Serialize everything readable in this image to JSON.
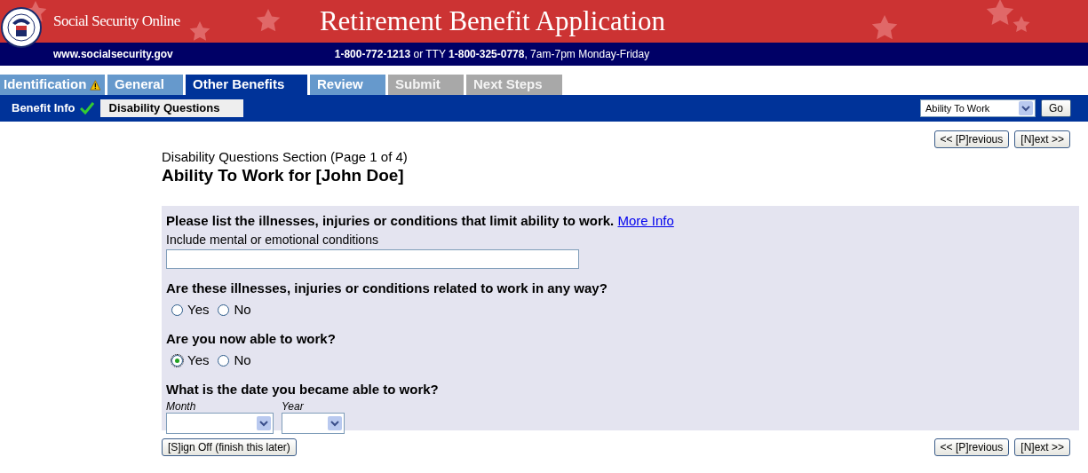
{
  "header": {
    "site": "Social Security Online",
    "title": "Retirement Benefit Application",
    "url": "www.socialsecurity.gov",
    "phone": "1-800-772-1213",
    "tty_label": "or TTY",
    "tty": "1-800-325-0778",
    "hours": ", 7am-7pm Monday-Friday"
  },
  "tabs": [
    {
      "label": "Identification",
      "selected": false,
      "disabled": false,
      "warning": true
    },
    {
      "label": "General",
      "selected": false,
      "disabled": false,
      "warning": false
    },
    {
      "label": "Other Benefits",
      "selected": true,
      "disabled": false,
      "warning": false
    },
    {
      "label": "Review",
      "selected": false,
      "disabled": false,
      "warning": false
    },
    {
      "label": "Submit",
      "selected": false,
      "disabled": true,
      "warning": false
    },
    {
      "label": "Next Steps",
      "selected": false,
      "disabled": true,
      "warning": false
    }
  ],
  "subtabs": [
    {
      "label": "Benefit Info",
      "selected": false,
      "done": true
    },
    {
      "label": "Disability Questions",
      "selected": true,
      "done": false
    }
  ],
  "jump": {
    "value": "Ability To Work",
    "button": "Go"
  },
  "nav_top": [
    "<< [P]revious",
    "[N]ext >>"
  ],
  "section": "Disability Questions Section (Page 1 of 4)",
  "heading": "Ability To Work for [John Doe]",
  "questions": [
    {
      "kind": "text",
      "label": "Please list the illnesses, injuries or conditions that limit ability to work.",
      "link": "More Info",
      "hint": "Include mental or emotional conditions"
    },
    {
      "kind": "radio",
      "label": "Are these illnesses, injuries or conditions related to work in any way?",
      "options": [
        {
          "label": "Yes",
          "selected": false
        },
        {
          "label": "No",
          "selected": false
        }
      ]
    },
    {
      "kind": "radio",
      "label": "Are you now able to work?",
      "options": [
        {
          "label": "Yes",
          "selected": true
        },
        {
          "label": "No",
          "selected": false
        }
      ]
    },
    {
      "kind": "date",
      "label": "What is the date you became able to work?",
      "fields": [
        {
          "label": "Month"
        },
        {
          "label": "Year"
        }
      ]
    }
  ],
  "sign_off": "[S]ign Off (finish this later)",
  "nav_bottom": [
    "<< [P]revious",
    "[N]ext >>"
  ]
}
